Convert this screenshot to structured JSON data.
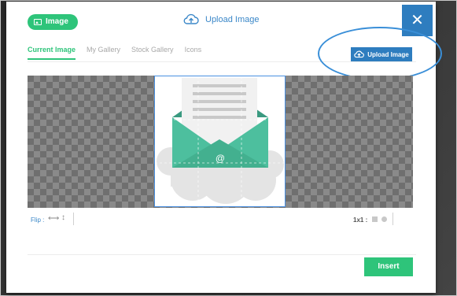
{
  "header": {
    "badge_label": "Image",
    "badge_icon": "image-icon",
    "title": "Upload Image",
    "title_icon": "cloud-upload-icon",
    "close_label": "✕"
  },
  "tabs": [
    {
      "label": "Current Image",
      "active": true
    },
    {
      "label": "My Gallery",
      "active": false
    },
    {
      "label": "Stock Gallery",
      "active": false
    },
    {
      "label": "Icons",
      "active": false
    }
  ],
  "upload_button": {
    "label": "Upload Image",
    "icon": "cloud-upload-icon"
  },
  "preview": {
    "subject": "email-envelope-illustration",
    "at_symbol": "@"
  },
  "tools": {
    "flip_label": "Flip :",
    "flip_horizontal_icon": "⟷",
    "flip_vertical_icon": "↕",
    "ratio_label": "1x1 :"
  },
  "footer": {
    "insert_label": "Insert"
  },
  "colors": {
    "green": "#2ec47a",
    "blue": "#2e7dbf",
    "teal": "#4dbf9e",
    "highlight": "#3a8fd8"
  }
}
